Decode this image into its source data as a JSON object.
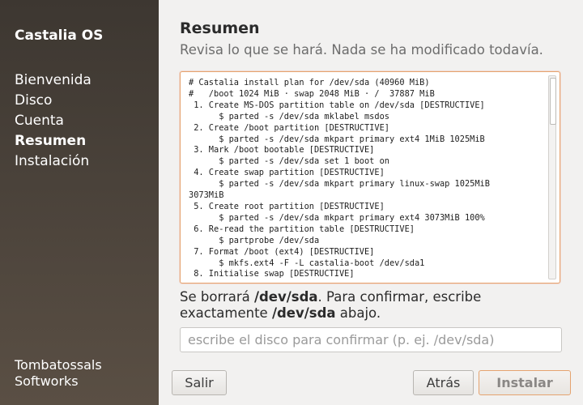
{
  "sidebar": {
    "brand": "Castalia OS",
    "items": [
      {
        "label": "Bienvenida"
      },
      {
        "label": "Disco"
      },
      {
        "label": "Cuenta"
      },
      {
        "label": "Resumen"
      },
      {
        "label": "Instalación"
      }
    ],
    "active_index": 3,
    "vendor_line1": "Tombatossals",
    "vendor_line2": "Softworks"
  },
  "main": {
    "title": "Resumen",
    "subtitle": "Revisa lo que se hará. Nada se ha modificado todavía.",
    "plan_text": "# Castalia install plan for /dev/sda (40960 MiB)\n#   /boot 1024 MiB · swap 2048 MiB · /  37887 MiB\n 1. Create MS-DOS partition table on /dev/sda [DESTRUCTIVE]\n      $ parted -s /dev/sda mklabel msdos\n 2. Create /boot partition [DESTRUCTIVE]\n      $ parted -s /dev/sda mkpart primary ext4 1MiB 1025MiB\n 3. Mark /boot bootable [DESTRUCTIVE]\n      $ parted -s /dev/sda set 1 boot on\n 4. Create swap partition [DESTRUCTIVE]\n      $ parted -s /dev/sda mkpart primary linux-swap 1025MiB\n3073MiB\n 5. Create root partition [DESTRUCTIVE]\n      $ parted -s /dev/sda mkpart primary ext4 3073MiB 100%\n 6. Re-read the partition table [DESTRUCTIVE]\n      $ partprobe /dev/sda\n 7. Format /boot (ext4) [DESTRUCTIVE]\n      $ mkfs.ext4 -F -L castalia-boot /dev/sda1\n 8. Initialise swap [DESTRUCTIVE]",
    "confirm": {
      "part1": "Se borrará ",
      "disk1": "/dev/sda",
      "part2": ". Para confirmar, escribe exactamente ",
      "disk2": "/dev/sda",
      "part3": " abajo."
    },
    "confirm_input": {
      "value": "",
      "placeholder": "escribe el disco para confirmar (p. ej. /dev/sda)"
    }
  },
  "buttons": {
    "quit": "Salir",
    "back": "Atrás",
    "install": "Instalar"
  },
  "colors": {
    "accent": "#e95420",
    "sidebar_top": "#3d3731",
    "sidebar_bottom": "#5a4f44",
    "background": "#f2f1f0"
  }
}
